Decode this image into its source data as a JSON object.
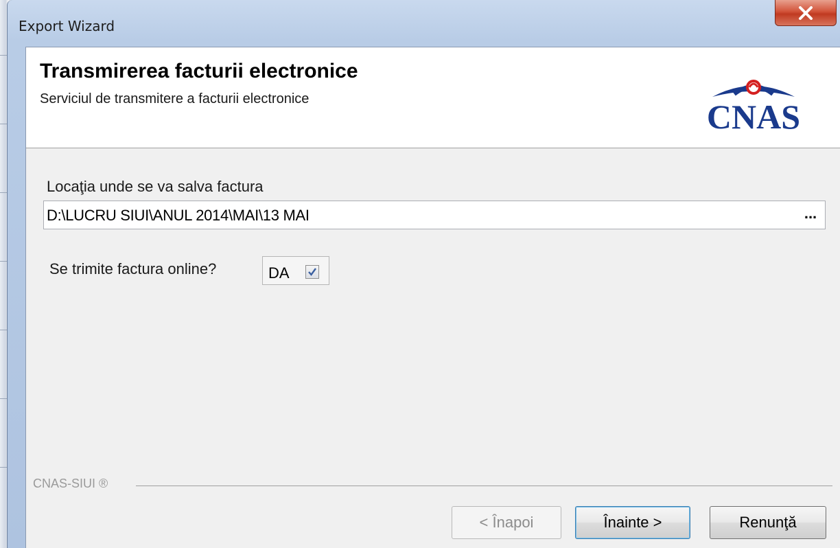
{
  "window": {
    "title": "Export Wizard",
    "close_glyph": "x"
  },
  "header": {
    "title": "Transmirerea facturii electronice",
    "subtitle": "Serviciul de transmitere a facturii electronice",
    "logo_text": "CNAS",
    "logo_color": "#1a3a8c",
    "logo_accent": "#d42020"
  },
  "location": {
    "label": "Locaţia unde se va salva factura",
    "value": "D:\\LUCRU SIUI\\ANUL 2014\\MAI\\13 MAI",
    "browse_label": "..."
  },
  "online": {
    "label": "Se trimite factura online?",
    "checkbox_label": "DA",
    "checked": true
  },
  "footer": {
    "brand": "CNAS-SIUI ®"
  },
  "buttons": {
    "back": "< Înapoi",
    "next": "Înainte >",
    "cancel": "Renunţă"
  }
}
